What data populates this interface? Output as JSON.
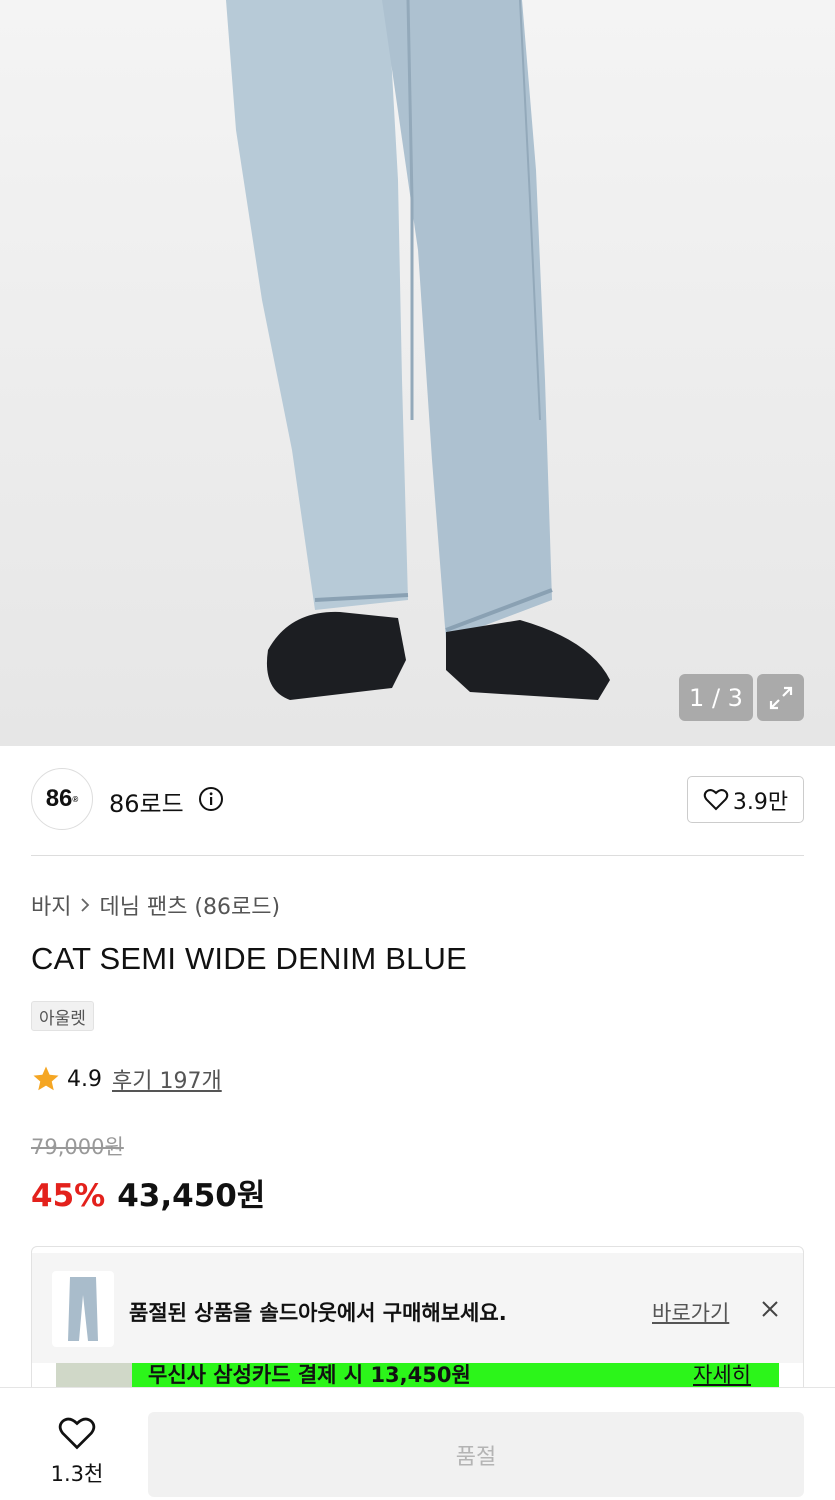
{
  "gallery": {
    "counter": "1 / 3"
  },
  "brand": {
    "logo_text": "86",
    "name": "86로드",
    "like_count": "3.9만"
  },
  "breadcrumb": {
    "category": "바지",
    "subcategory": "데님 팬츠 (86로드)"
  },
  "product": {
    "title": "CAT SEMI WIDE DENIM BLUE",
    "tag": "아울렛",
    "rating": "4.9",
    "reviews": "후기 197개",
    "original_price": "79,000원",
    "discount": "45%",
    "sale_price": "43,450원"
  },
  "soldout_notice": {
    "text": "품절된 상품을 솔드아웃에서 구매해보세요.",
    "link": "바로가기"
  },
  "card_promo": {
    "text": "무신사 삼성카드 결제 시 13,450원",
    "link": "자세히"
  },
  "bottom": {
    "wish_count": "1.3천",
    "button_label": "품절"
  },
  "colors": {
    "discount": "#e3211c",
    "promo_bar": "#2cf51a",
    "star": "#f5a623"
  }
}
